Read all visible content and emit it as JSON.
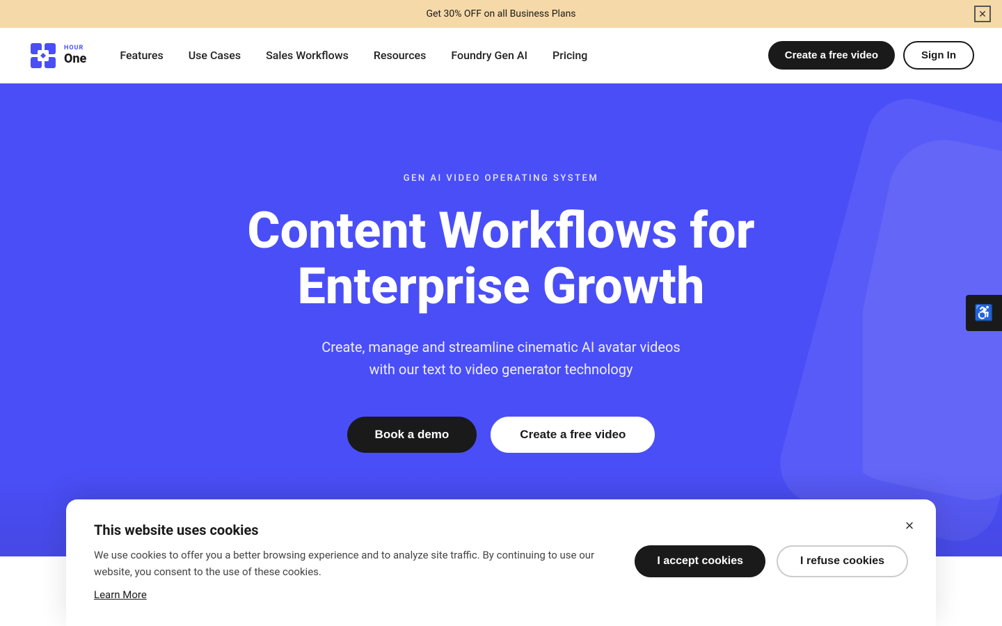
{
  "announcement": {
    "text": "Get 30% OFF on all Business Plans",
    "close_label": "✕"
  },
  "nav": {
    "logo_text": "Hour One",
    "links": [
      {
        "label": "Features"
      },
      {
        "label": "Use Cases"
      },
      {
        "label": "Sales Workflows"
      },
      {
        "label": "Resources"
      },
      {
        "label": "Foundry Gen AI"
      },
      {
        "label": "Pricing"
      }
    ],
    "cta_primary": "Create a free video",
    "cta_secondary": "Sign In"
  },
  "hero": {
    "eyebrow": "GEN AI VIDEO OPERATING SYSTEM",
    "title_line1": "Content Workflows for",
    "title_line2": "Enterprise Growth",
    "subtitle_line1": "Create, manage and streamline cinematic AI avatar videos",
    "subtitle_line2": "with our text to video generator technology",
    "btn_demo": "Book a demo",
    "btn_free": "Create a free video"
  },
  "accessibility": {
    "icon": "♿"
  },
  "cookie": {
    "title": "This website uses cookies",
    "text": "We use cookies to offer you a better browsing experience and to analyze site traffic. By continuing to use our website, you consent to the use of these cookies.",
    "learn_more": "Learn More",
    "accept": "I accept cookies",
    "refuse": "I refuse cookies",
    "close_label": "×"
  }
}
